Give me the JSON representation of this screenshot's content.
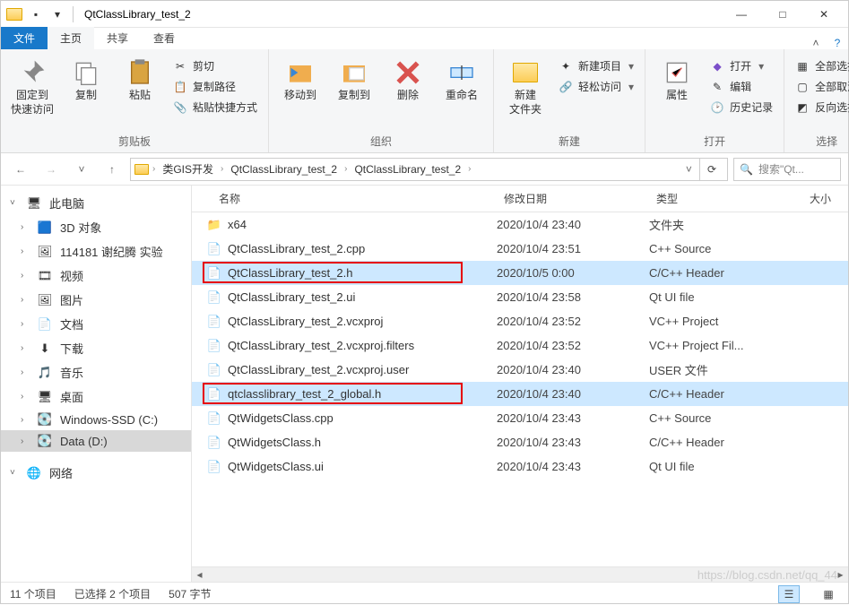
{
  "window": {
    "title": "QtClassLibrary_test_2",
    "min": "—",
    "max": "□",
    "close": "✕"
  },
  "tabs": {
    "file": "文件",
    "home": "主页",
    "share": "共享",
    "view": "查看"
  },
  "ribbon": {
    "clipboard": {
      "pin": "固定到\n快速访问",
      "copy": "复制",
      "paste": "粘贴",
      "cut": "剪切",
      "copypath": "复制路径",
      "pasteshortcut": "粘贴快捷方式",
      "label": "剪贴板"
    },
    "organize": {
      "moveto": "移动到",
      "copyto": "复制到",
      "delete": "删除",
      "rename": "重命名",
      "label": "组织"
    },
    "new": {
      "newfolder": "新建\n文件夹",
      "newitem": "新建项目",
      "easyaccess": "轻松访问",
      "label": "新建"
    },
    "open": {
      "properties": "属性",
      "open": "打开",
      "edit": "编辑",
      "history": "历史记录",
      "label": "打开"
    },
    "select": {
      "selectall": "全部选择",
      "selectnone": "全部取消",
      "invert": "反向选择",
      "label": "选择"
    }
  },
  "breadcrumbs": [
    "类GIS开发",
    "QtClassLibrary_test_2",
    "QtClassLibrary_test_2"
  ],
  "search_placeholder": "搜索\"Qt...",
  "columns": {
    "name": "名称",
    "date": "修改日期",
    "type": "类型",
    "size": "大小"
  },
  "navtree": [
    {
      "label": "此电脑",
      "icon": "pc",
      "root": true
    },
    {
      "label": "3D 对象",
      "icon": "3d"
    },
    {
      "label": "114181 谢纪腾 实验",
      "icon": "drive-net"
    },
    {
      "label": "视频",
      "icon": "video"
    },
    {
      "label": "图片",
      "icon": "pictures"
    },
    {
      "label": "文档",
      "icon": "docs"
    },
    {
      "label": "下载",
      "icon": "downloads"
    },
    {
      "label": "音乐",
      "icon": "music"
    },
    {
      "label": "桌面",
      "icon": "desktop"
    },
    {
      "label": "Windows-SSD (C:)",
      "icon": "disk"
    },
    {
      "label": "Data (D:)",
      "icon": "disk",
      "selected": true
    },
    {
      "label": "网络",
      "icon": "network",
      "root": true
    }
  ],
  "files": [
    {
      "name": "x64",
      "date": "2020/10/4 23:40",
      "type": "文件夹",
      "icon": "folder"
    },
    {
      "name": "QtClassLibrary_test_2.cpp",
      "date": "2020/10/4 23:51",
      "type": "C++ Source",
      "icon": "cpp"
    },
    {
      "name": "QtClassLibrary_test_2.h",
      "date": "2020/10/5 0:00",
      "type": "C/C++ Header",
      "icon": "h",
      "selected": true,
      "redbox": true
    },
    {
      "name": "QtClassLibrary_test_2.ui",
      "date": "2020/10/4 23:58",
      "type": "Qt UI file",
      "icon": "ui"
    },
    {
      "name": "QtClassLibrary_test_2.vcxproj",
      "date": "2020/10/4 23:52",
      "type": "VC++ Project",
      "icon": "vcx"
    },
    {
      "name": "QtClassLibrary_test_2.vcxproj.filters",
      "date": "2020/10/4 23:52",
      "type": "VC++ Project Fil...",
      "icon": "vcx"
    },
    {
      "name": "QtClassLibrary_test_2.vcxproj.user",
      "date": "2020/10/4 23:40",
      "type": "USER 文件",
      "icon": "vs"
    },
    {
      "name": "qtclasslibrary_test_2_global.h",
      "date": "2020/10/4 23:40",
      "type": "C/C++ Header",
      "icon": "h",
      "selected": true,
      "redbox": true
    },
    {
      "name": "QtWidgetsClass.cpp",
      "date": "2020/10/4 23:43",
      "type": "C++ Source",
      "icon": "cpp"
    },
    {
      "name": "QtWidgetsClass.h",
      "date": "2020/10/4 23:43",
      "type": "C/C++ Header",
      "icon": "h"
    },
    {
      "name": "QtWidgetsClass.ui",
      "date": "2020/10/4 23:43",
      "type": "Qt UI file",
      "icon": "ui"
    }
  ],
  "status": {
    "items": "11 个项目",
    "selected": "已选择 2 个项目",
    "bytes": "507 字节"
  },
  "watermark": "https://blog.csdn.net/qq_44"
}
